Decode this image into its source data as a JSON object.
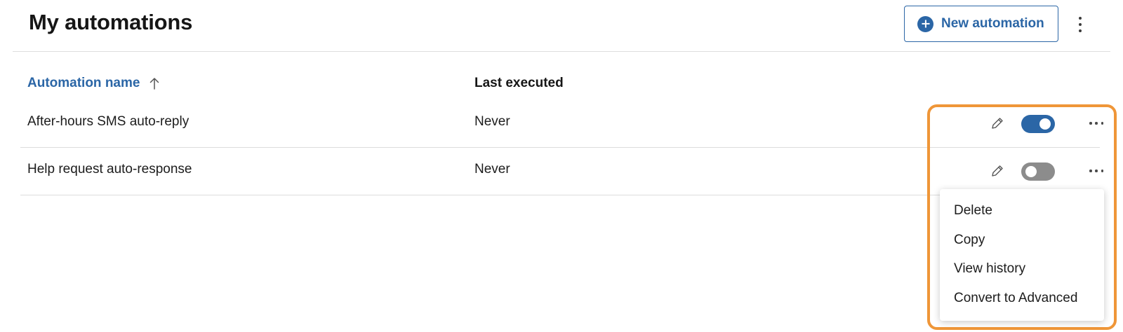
{
  "header": {
    "title": "My automations",
    "new_button_label": "New automation",
    "new_button_icon": "plus-circle-icon",
    "overflow_icon": "vertical-kebab-icon"
  },
  "table": {
    "columns": [
      {
        "label": "Automation name",
        "sort": "ascending",
        "sort_icon": "arrow-up-icon"
      },
      {
        "label": "Last executed"
      }
    ],
    "rows": [
      {
        "name": "After-hours SMS auto-reply",
        "last_executed": "Never",
        "enabled": true
      },
      {
        "name": "Help request auto-response",
        "last_executed": "Never",
        "enabled": false
      }
    ]
  },
  "row_menu": {
    "items": [
      {
        "label": "Delete"
      },
      {
        "label": "Copy"
      },
      {
        "label": "View history"
      },
      {
        "label": "Convert to Advanced"
      }
    ]
  },
  "colors": {
    "accent": "#2b66a6",
    "highlight": "#ef9638",
    "toggle_off": "#8c8c8c"
  }
}
